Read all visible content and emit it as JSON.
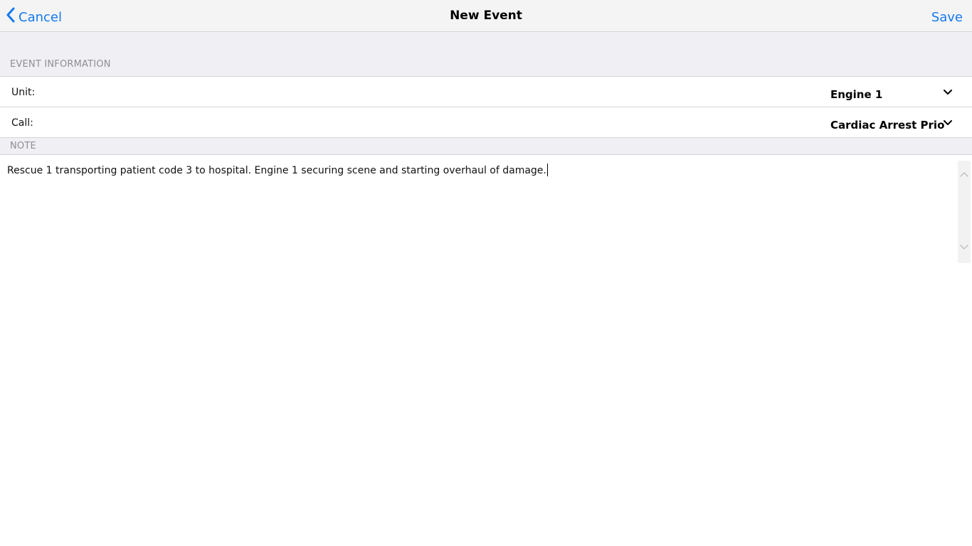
{
  "navbar": {
    "back_label": "Cancel",
    "title": "New Event",
    "save_label": "Save"
  },
  "sections": {
    "event_information": "EVENT INFORMATION",
    "note": "NOTE"
  },
  "fields": [
    {
      "label": "Unit:",
      "value": "Engine 1",
      "icon": "chevron-down-icon"
    },
    {
      "label": "Call:",
      "value": "Cardiac Arrest Prio",
      "icon": "chevron-down-icon"
    }
  ],
  "note": {
    "text": "Rescue 1 transporting patient code 3 to hospital. Engine 1 securing scene and starting overhaul of damage."
  },
  "colors": {
    "accent": "#1479f0",
    "grouped_background": "#efeff4",
    "separator": "#d5d5d8",
    "section_header_text": "#8e8e93"
  }
}
